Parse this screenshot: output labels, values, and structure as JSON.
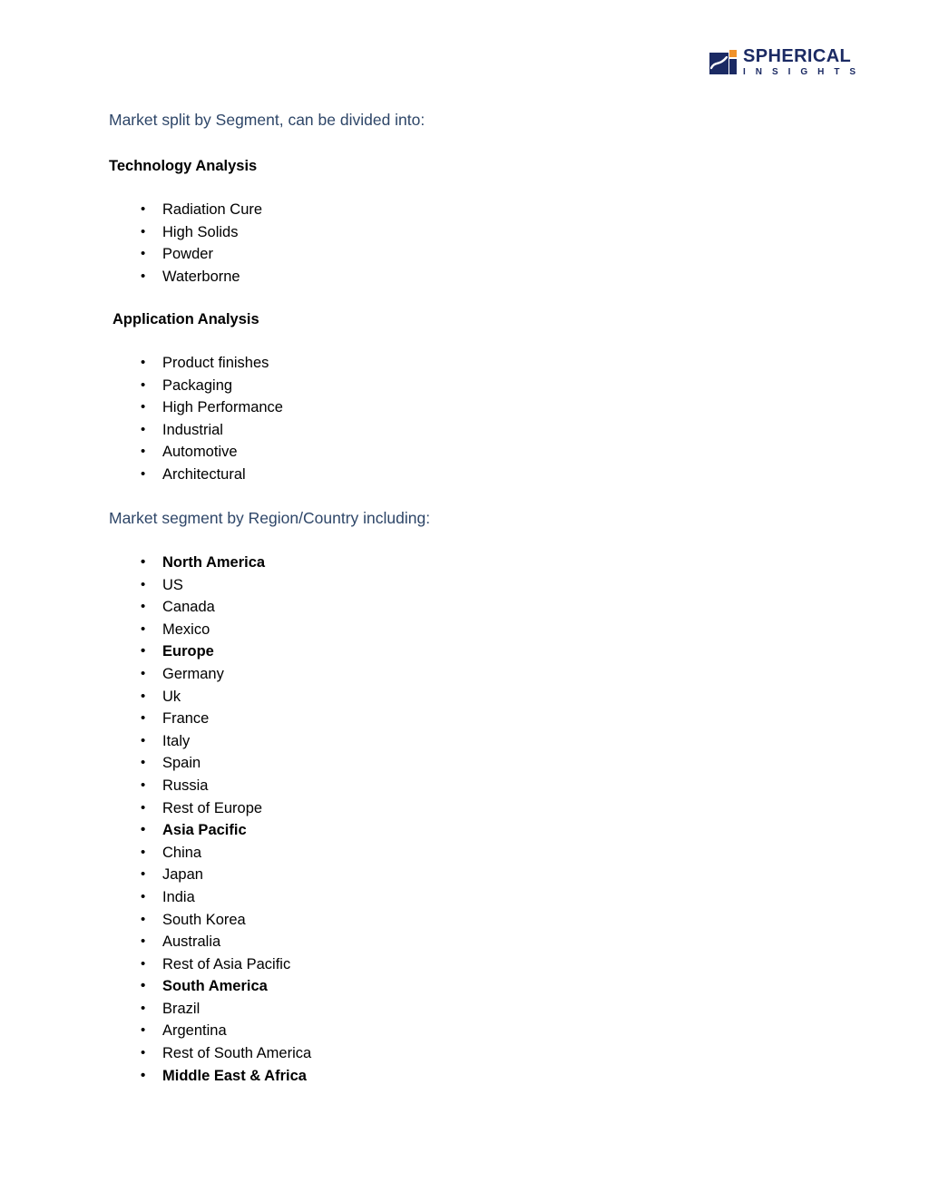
{
  "logo": {
    "name": "SPHERICAL",
    "subtitle": "I N S I G H T S",
    "mark_icon": "spherical-insights-logo-icon",
    "navy": "#1B2A63",
    "orange": "#F0922B"
  },
  "document": {
    "heading_color": "#2E4668",
    "segment_intro": "Market split by Segment, can be divided into:",
    "region_intro": "Market segment by Region/Country including:",
    "sections": [
      {
        "title": "Technology Analysis",
        "items": [
          {
            "label": "Radiation Cure",
            "bold": false
          },
          {
            "label": "High Solids",
            "bold": false
          },
          {
            "label": "Powder",
            "bold": false
          },
          {
            "label": "Waterborne",
            "bold": false
          }
        ]
      },
      {
        "title": "Application Analysis",
        "items": [
          {
            "label": "Product finishes",
            "bold": false
          },
          {
            "label": "Packaging",
            "bold": false
          },
          {
            "label": "High Performance",
            "bold": false
          },
          {
            "label": "Industrial",
            "bold": false
          },
          {
            "label": "Automotive",
            "bold": false
          },
          {
            "label": "Architectural",
            "bold": false
          }
        ]
      }
    ],
    "regions": [
      {
        "label": "North America",
        "bold": true
      },
      {
        "label": "US",
        "bold": false
      },
      {
        "label": "Canada",
        "bold": false
      },
      {
        "label": "Mexico",
        "bold": false
      },
      {
        "label": "Europe",
        "bold": true
      },
      {
        "label": "Germany",
        "bold": false
      },
      {
        "label": "Uk",
        "bold": false
      },
      {
        "label": "France",
        "bold": false
      },
      {
        "label": "Italy",
        "bold": false
      },
      {
        "label": "Spain",
        "bold": false
      },
      {
        "label": "Russia",
        "bold": false
      },
      {
        "label": "Rest of Europe",
        "bold": false
      },
      {
        "label": "Asia Pacific",
        "bold": true
      },
      {
        "label": "China",
        "bold": false
      },
      {
        "label": "Japan",
        "bold": false
      },
      {
        "label": "India",
        "bold": false
      },
      {
        "label": "South Korea",
        "bold": false
      },
      {
        "label": "Australia",
        "bold": false
      },
      {
        "label": "Rest of Asia Pacific",
        "bold": false
      },
      {
        "label": "South America",
        "bold": true
      },
      {
        "label": "Brazil",
        "bold": false
      },
      {
        "label": "Argentina",
        "bold": false
      },
      {
        "label": "Rest of South America",
        "bold": false
      },
      {
        "label": "Middle East & Africa",
        "bold": true
      }
    ]
  }
}
